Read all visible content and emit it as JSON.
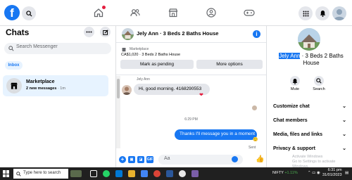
{
  "topbar": {
    "logo": "f",
    "icons": [
      "search-icon",
      "home-icon",
      "friends-icon",
      "marketplace-icon",
      "groups-icon",
      "gaming-icon",
      "menu-grid-icon",
      "bell-icon",
      "profile-avatar"
    ]
  },
  "left": {
    "title": "Chats",
    "search_placeholder": "Search Messenger",
    "inbox_tab": "Inbox",
    "conversations": [
      {
        "name": "Marketplace",
        "unread": "2 new messages",
        "time": " · 1m"
      }
    ]
  },
  "mid": {
    "header_title": "Jely Ann · 3 Beds 2 Baths House",
    "listing_label": "Marketplace",
    "listing_price": "CA$1,020 · 3 Beds 2 Baths House",
    "mark_pending": "Mark as pending",
    "more_options": "More options",
    "sender_name": "Jely Ann",
    "incoming_message": "Hi, good morning. 4168290553",
    "time_label": "6:29 PM",
    "outgoing_message": "Thanks I'll message you in a moment",
    "sent_label": "Sent",
    "compose_placeholder": "Aa"
  },
  "right": {
    "title_highlight": "Jely Ann",
    "title_rest": " · 3 Beds 2 Baths House",
    "mute_label": "Mute",
    "search_label": "Search",
    "menu": [
      "Customize chat",
      "Chat members",
      "Media, files and links",
      "Privacy & support"
    ],
    "watermark_1": "Activate Windows",
    "watermark_2": "Go to Settings to activate Windows."
  },
  "taskbar": {
    "search_placeholder": "Type here to search",
    "nifty_label": "NIFTY",
    "nifty_change": "+1.11%",
    "time": "6:31 pm",
    "date": "31/01/2023"
  },
  "colors": {
    "accent": "#1877f2",
    "bg": "#f0f2f5",
    "taskbar": "#202020",
    "nifty_up": "#4caf50"
  }
}
